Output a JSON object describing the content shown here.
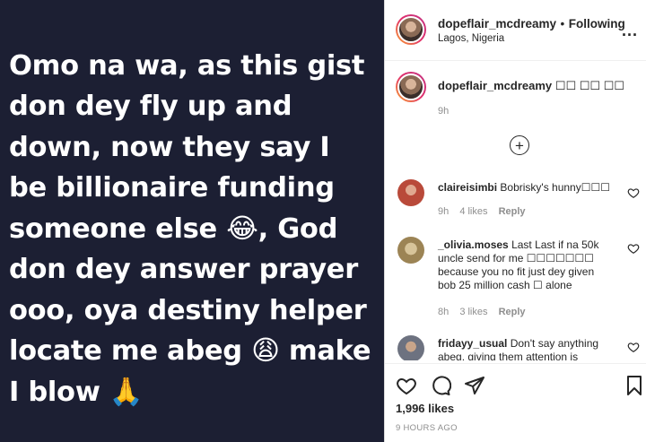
{
  "story": {
    "text": "Omo na wa, as this gist\ndon dey fly up and\ndown, now they say I\nbe billionaire funding\nsomeone else 😂, God\ndon dey answer prayer\nooo, oya destiny helper\nlocate me abeg 😩 make\nI blow 🙏"
  },
  "header": {
    "username": "dopeflair_mcdreamy",
    "separator": "•",
    "follow_status": "Following",
    "location": "Lagos, Nigeria",
    "more": "..."
  },
  "caption": {
    "username": "dopeflair_mcdreamy",
    "text": "☐☐ ☐☐ ☐☐",
    "time": "9h"
  },
  "load_more_symbol": "+",
  "comments": [
    {
      "username": "claireisimbi",
      "text": "Bobrisky's hunny☐☐☐",
      "time": "9h",
      "likes": "4 likes",
      "reply": "Reply",
      "avatar_color": "#b94a3a"
    },
    {
      "username": "_olivia.moses",
      "text": "Last Last if na 50k uncle send for me ☐☐☐☐☐☐☐ because you no fit just dey given bob 25 million cash ☐ alone",
      "time": "8h",
      "likes": "3 likes",
      "reply": "Reply",
      "avatar_color": "#b89a6a"
    },
    {
      "username": "fridayy_usual",
      "text": "Don't say anything abeg, giving them attention is",
      "time": "",
      "likes": "",
      "reply": "",
      "avatar_color": "#7a7f8a"
    }
  ],
  "actions": {
    "likes_count": "1,996 likes",
    "time_ago": "9 HOURS AGO"
  }
}
